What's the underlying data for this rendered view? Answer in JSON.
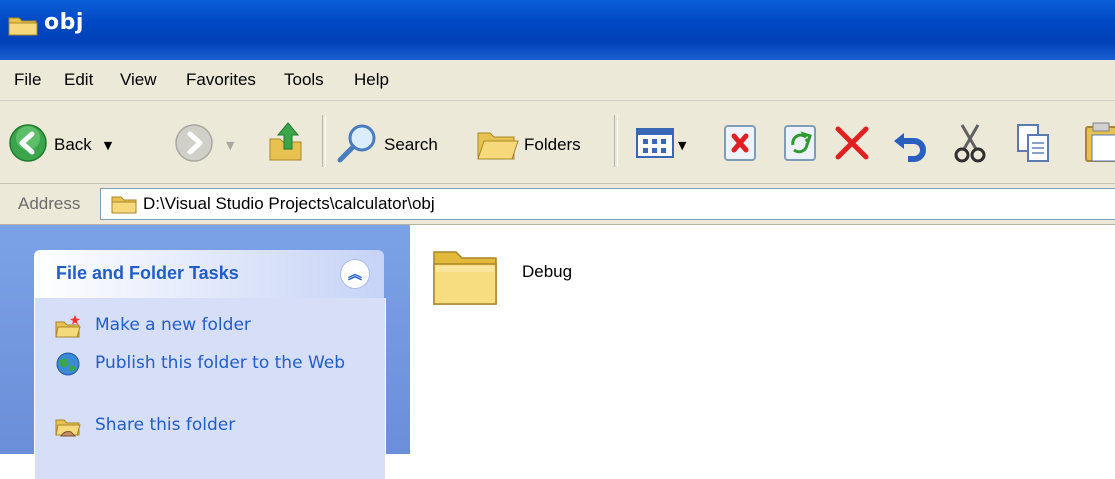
{
  "window": {
    "title": "obj"
  },
  "menubar": {
    "items": [
      "File",
      "Edit",
      "View",
      "Favorites",
      "Tools",
      "Help"
    ]
  },
  "toolbar": {
    "back_label": "Back",
    "search_label": "Search",
    "folders_label": "Folders",
    "icons": [
      "back-arrow-icon",
      "forward-arrow-icon",
      "up-folder-icon",
      "search-icon",
      "folders-icon",
      "views-icon",
      "delete-file-icon",
      "sync-icon",
      "delete-x-icon",
      "undo-icon",
      "cut-icon",
      "copy-icon",
      "paste-icon"
    ]
  },
  "address": {
    "label": "Address",
    "path": "D:\\Visual Studio Projects\\calculator\\obj"
  },
  "task_pane": {
    "title": "File and Folder Tasks",
    "links": [
      {
        "label": "Make a new folder",
        "icon": "new-folder-icon"
      },
      {
        "label": "Publish this folder to the Web",
        "icon": "publish-globe-icon"
      },
      {
        "label": "Share this folder",
        "icon": "share-folder-icon"
      }
    ]
  },
  "content": {
    "items": [
      {
        "name": "Debug",
        "type": "folder"
      }
    ]
  },
  "colors": {
    "titlebar": "#0049c4",
    "chrome": "#ece9d8",
    "taskpane": "#6b8ed8",
    "task_link": "#215dc6"
  }
}
